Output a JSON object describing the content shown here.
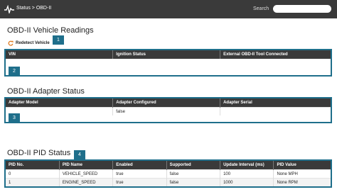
{
  "header": {
    "breadcrumb": "Status > OBD-II",
    "search_label": "Search",
    "search_value": ""
  },
  "vehicle_readings": {
    "title": "OBD-II Vehicle Readings",
    "badge": "1",
    "redetect_label": "Redetect Vehicle",
    "table_badge": "2",
    "columns": [
      "VIN",
      "Ignition Status",
      "External OBD-II Tool Connected"
    ]
  },
  "adapter_status": {
    "title": "OBD-II Adapter Status",
    "badge": "3",
    "columns": [
      "Adapter Model",
      "Adapter Configured",
      "Adapter Serial"
    ],
    "row": [
      "",
      "false",
      ""
    ]
  },
  "pid_status": {
    "title": "OBD-II PID Status",
    "badge": "4",
    "columns": [
      "PID No.",
      "PID Name",
      "Enabled",
      "Supported",
      "Update Interval (ms)",
      "PID Value"
    ],
    "rows": [
      [
        "0",
        "VEHICLE_SPEED",
        "true",
        "false",
        "100",
        "None MPH"
      ],
      [
        "1",
        "ENGINE_SPEED",
        "true",
        "false",
        "1000",
        "None RPM"
      ]
    ]
  },
  "colors": {
    "header_bg": "#3a3a3a",
    "accent": "#1f6f8b",
    "refresh_icon": "#e07a1f"
  },
  "icons": {
    "logo": "pulse-wave-icon",
    "redetect": "refresh-icon"
  }
}
